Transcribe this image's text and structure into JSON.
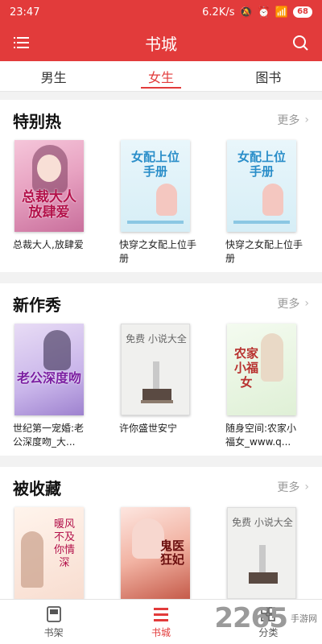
{
  "status_bar": {
    "time": "23:47",
    "network": "6.2K/s",
    "battery": "68"
  },
  "app_bar": {
    "title": "书城"
  },
  "tabs": [
    {
      "label": "男生"
    },
    {
      "label": "女生"
    },
    {
      "label": "图书"
    }
  ],
  "sections": [
    {
      "title": "特别热",
      "more": "更多",
      "books": [
        {
          "title": "总裁大人,放肆爱",
          "cover_text": "总裁大人放肆爱"
        },
        {
          "title": "快穿之女配上位手册",
          "cover_text": "女配上位手册"
        },
        {
          "title": "快穿之女配上位手册",
          "cover_text": "女配上位手册"
        }
      ]
    },
    {
      "title": "新作秀",
      "more": "更多",
      "books": [
        {
          "title": "世纪第一宠婚:老公深度吻_大...",
          "cover_text": "老公深度吻"
        },
        {
          "title": "许你盛世安宁",
          "cover_text": "免费 小说大全"
        },
        {
          "title": "随身空间:农家小福女_www.q...",
          "cover_text": "农家小福女"
        }
      ]
    },
    {
      "title": "被收藏",
      "more": "更多",
      "books": [
        {
          "title": "",
          "cover_text": "暖风不及你情深"
        },
        {
          "title": "",
          "cover_text": "鬼医狂妃"
        },
        {
          "title": "",
          "cover_text": "免费 小说大全"
        }
      ]
    }
  ],
  "bottom_nav": [
    {
      "label": "书架",
      "icon": "bookshelf-icon"
    },
    {
      "label": "书城",
      "icon": "bookstore-icon"
    },
    {
      "label": "分类",
      "icon": "category-icon"
    }
  ],
  "watermark": {
    "number": "2265",
    "text": "手游网"
  },
  "colors": {
    "accent": "#e23b3b"
  }
}
